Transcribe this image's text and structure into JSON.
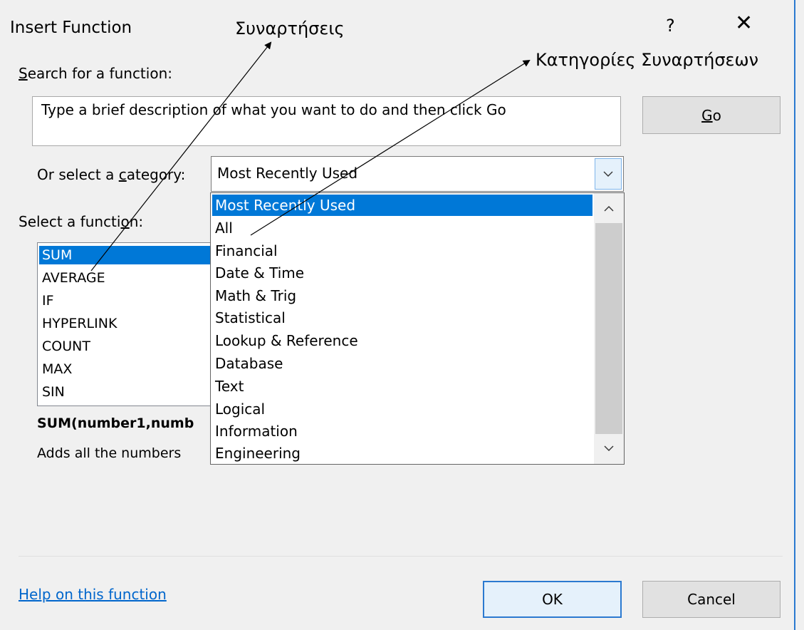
{
  "window": {
    "title": "Insert Function",
    "help_glyph": "?",
    "close_glyph": "✕"
  },
  "annotations": {
    "functions": "Συναρτήσεις",
    "categories": "Κατηγορίες Συναρτήσεων"
  },
  "search": {
    "label_access_key": "S",
    "label_rest": "earch for a function:",
    "value": "Type a brief description of what you want to do and then click Go",
    "go_access_key": "G",
    "go_rest": "o"
  },
  "category": {
    "label_pre": "Or select a ",
    "label_access_key": "c",
    "label_post": "ategory:",
    "selected": "Most Recently Used",
    "options": [
      "Most Recently Used",
      "All",
      "Financial",
      "Date & Time",
      "Math & Trig",
      "Statistical",
      "Lookup & Reference",
      "Database",
      "Text",
      "Logical",
      "Information",
      "Engineering"
    ]
  },
  "functions": {
    "label_pre": "Select a functi",
    "label_access_key": "o",
    "label_post": "n:",
    "items": [
      "SUM",
      "AVERAGE",
      "IF",
      "HYPERLINK",
      "COUNT",
      "MAX",
      "SIN"
    ],
    "selected": "SUM",
    "signature": "SUM(number1,numb",
    "description": "Adds all the numbers"
  },
  "footer": {
    "help_link": "Help on this function",
    "ok": "OK",
    "cancel": "Cancel"
  },
  "colors": {
    "selection": "#0078d7",
    "focus_border": "#2b79d0",
    "link": "#0066cc"
  }
}
